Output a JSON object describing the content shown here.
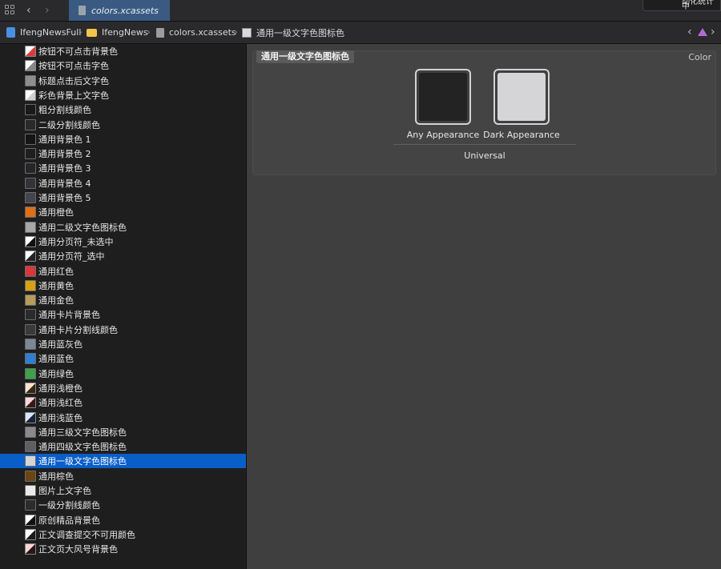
{
  "tab": {
    "title": "colors.xcassets"
  },
  "popup": {
    "text": "动化统计中"
  },
  "breadcrumb": [
    {
      "label": "IfengNewsFull",
      "icon": "project-icon"
    },
    {
      "label": "IfengNews",
      "icon": "folder-icon"
    },
    {
      "label": "colors.xcassets",
      "icon": "asset-catalog-icon"
    },
    {
      "label": "通用一级文字色图标色",
      "icon": "color-swatch-icon"
    }
  ],
  "colors": {
    "accent_selection": "#0a5ec8",
    "warning": "#b56ad6"
  },
  "sidebar": {
    "items": [
      {
        "label": "按钮不可点击背景色",
        "c1": "#ffffff",
        "c2": "#d93b3b",
        "dual": true
      },
      {
        "label": "按钮不可点击字色",
        "c1": "#ffffff",
        "c2": "#888888",
        "dual": true
      },
      {
        "label": "标题点击后文字色",
        "c1": "#8e8e8e"
      },
      {
        "label": "彩色背景上文字色",
        "c1": "#ffffff",
        "c2": "#cfcfcf",
        "dual": true
      },
      {
        "label": "粗分割线颜色",
        "c1": "#1a1a1a"
      },
      {
        "label": "二级分割线颜色",
        "c1": "#2a2a2a"
      },
      {
        "label": "通用背景色 1",
        "c1": "#151515"
      },
      {
        "label": "通用背景色 2",
        "c1": "#1f1f1f"
      },
      {
        "label": "通用背景色 3",
        "c1": "#26262a"
      },
      {
        "label": "通用背景色 4",
        "c1": "#33333a"
      },
      {
        "label": "通用背景色 5",
        "c1": "#45454d"
      },
      {
        "label": "通用橙色",
        "c1": "#e06f14"
      },
      {
        "label": "通用二级文字色图标色",
        "c1": "#a7a7aa"
      },
      {
        "label": "通用分页符_未选中",
        "c1": "#ffffff",
        "c2": "#111111",
        "dual": true
      },
      {
        "label": "通用分页符_选中",
        "c1": "#ffffff",
        "c2": "#222222",
        "dual": true
      },
      {
        "label": "通用红色",
        "c1": "#d9383a"
      },
      {
        "label": "通用黄色",
        "c1": "#d6a012"
      },
      {
        "label": "通用金色",
        "c1": "#b89a5a"
      },
      {
        "label": "通用卡片背景色",
        "c1": "#2b2b2e"
      },
      {
        "label": "通用卡片分割线颜色",
        "c1": "#3a3a3d"
      },
      {
        "label": "通用蓝灰色",
        "c1": "#7b8896"
      },
      {
        "label": "通用蓝色",
        "c1": "#2f7fd6"
      },
      {
        "label": "通用绿色",
        "c1": "#3fa04a"
      },
      {
        "label": "通用浅橙色",
        "c1": "#fbe3cc",
        "c2": "#3a2615",
        "dual": true
      },
      {
        "label": "通用浅红色",
        "c1": "#fbd6d6",
        "c2": "#3a1818",
        "dual": true
      },
      {
        "label": "通用浅蓝色",
        "c1": "#d6e6fb",
        "c2": "#18243a",
        "dual": true
      },
      {
        "label": "通用三级文字色图标色",
        "c1": "#8a8a8e"
      },
      {
        "label": "通用四级文字色图标色",
        "c1": "#5f5f63"
      },
      {
        "label": "通用一级文字色图标色",
        "c1": "#d5d5d8",
        "selected": true
      },
      {
        "label": "通用棕色",
        "c1": "#6b4514"
      },
      {
        "label": "图片上文字色",
        "c1": "#e9e9e9"
      },
      {
        "label": "一级分割线颜色",
        "c1": "#2c2c2c"
      },
      {
        "label": "原创精品背景色",
        "c1": "#ffffff",
        "c2": "#111111",
        "dual": true
      },
      {
        "label": "正文调查提交不可用颜色",
        "c1": "#ffffff",
        "c2": "#1c1c1c",
        "dual": true
      },
      {
        "label": "正文页大风号背景色",
        "c1": "#fbd6d6",
        "c2": "#2b1515",
        "dual": true
      }
    ]
  },
  "editor": {
    "set_title": "通用一级文字色图标色",
    "kind": "Color",
    "wells": [
      {
        "label": "Any Appearance",
        "color": "#232323"
      },
      {
        "label": "Dark Appearance",
        "color": "#d5d5d8"
      }
    ],
    "group_label": "Universal"
  }
}
